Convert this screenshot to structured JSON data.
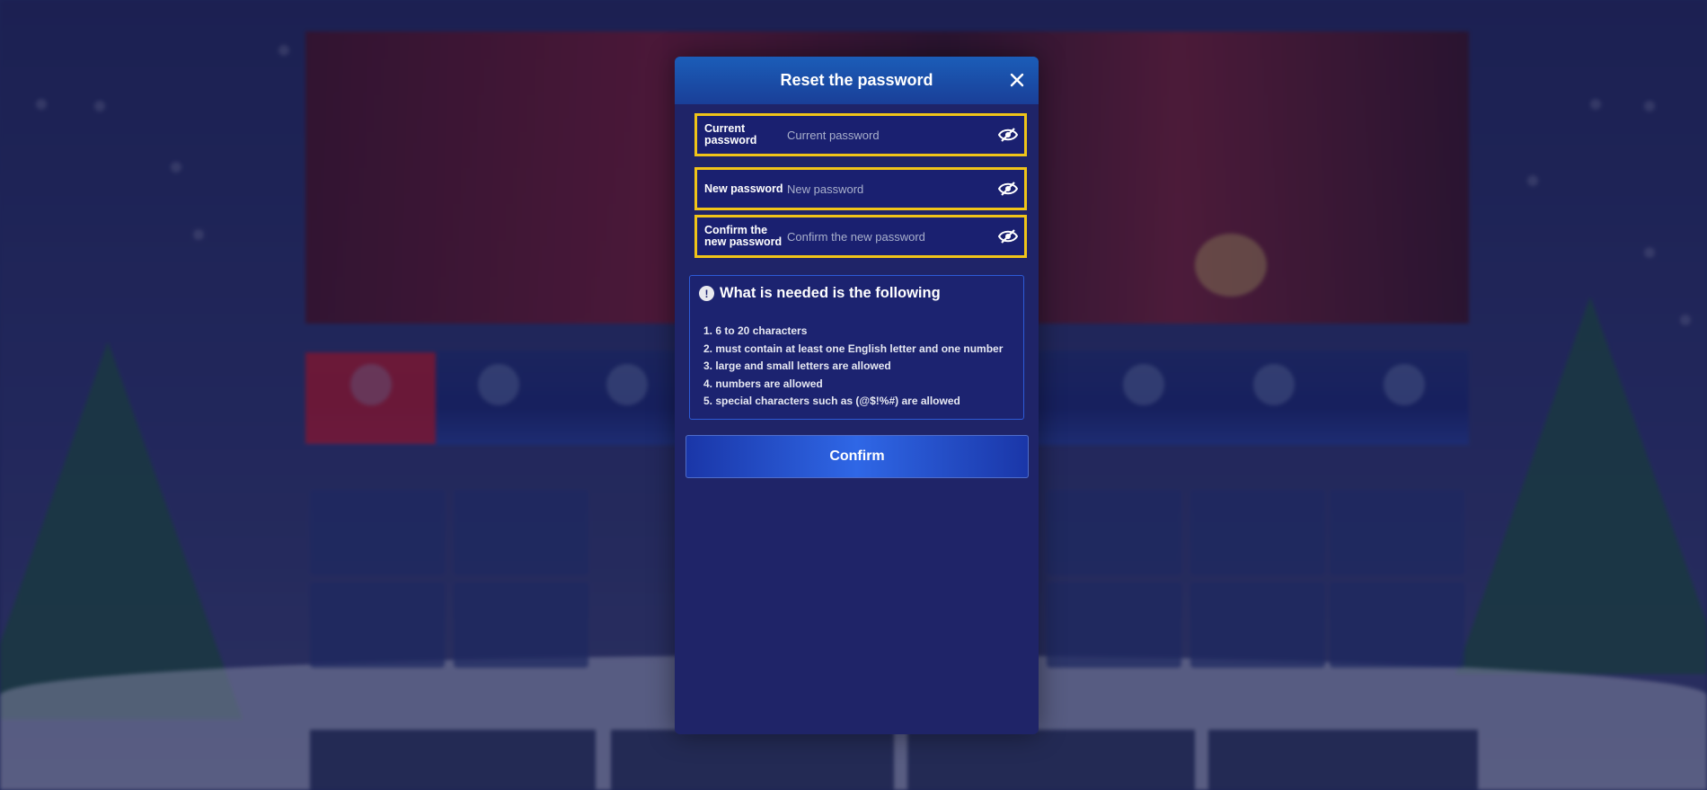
{
  "modal": {
    "title": "Reset the password",
    "close_icon": "close-icon",
    "fields": [
      {
        "label": "Current password",
        "placeholder": "Current password",
        "value": "",
        "icon": "eye-slash-icon"
      },
      {
        "label": "New password",
        "placeholder": "New password",
        "value": "",
        "icon": "eye-slash-icon"
      },
      {
        "label": "Confirm the new password",
        "placeholder": "Confirm the new password",
        "value": "",
        "icon": "eye-slash-icon"
      }
    ],
    "requirements": {
      "icon": "info-icon",
      "icon_glyph": "!",
      "title": "What is needed is the following",
      "items": [
        "1. 6 to 20 characters",
        "2. must contain at least one English letter and one number",
        "3. large and small letters are allowed",
        "4. numbers are allowed",
        "5. special characters such as (@$!%#) are allowed"
      ]
    },
    "confirm_label": "Confirm"
  },
  "colors": {
    "field_border": "#f0c419",
    "modal_bg": "#1f2468",
    "header_bg": "#1b5db8",
    "button_accent": "#2f67e6"
  }
}
